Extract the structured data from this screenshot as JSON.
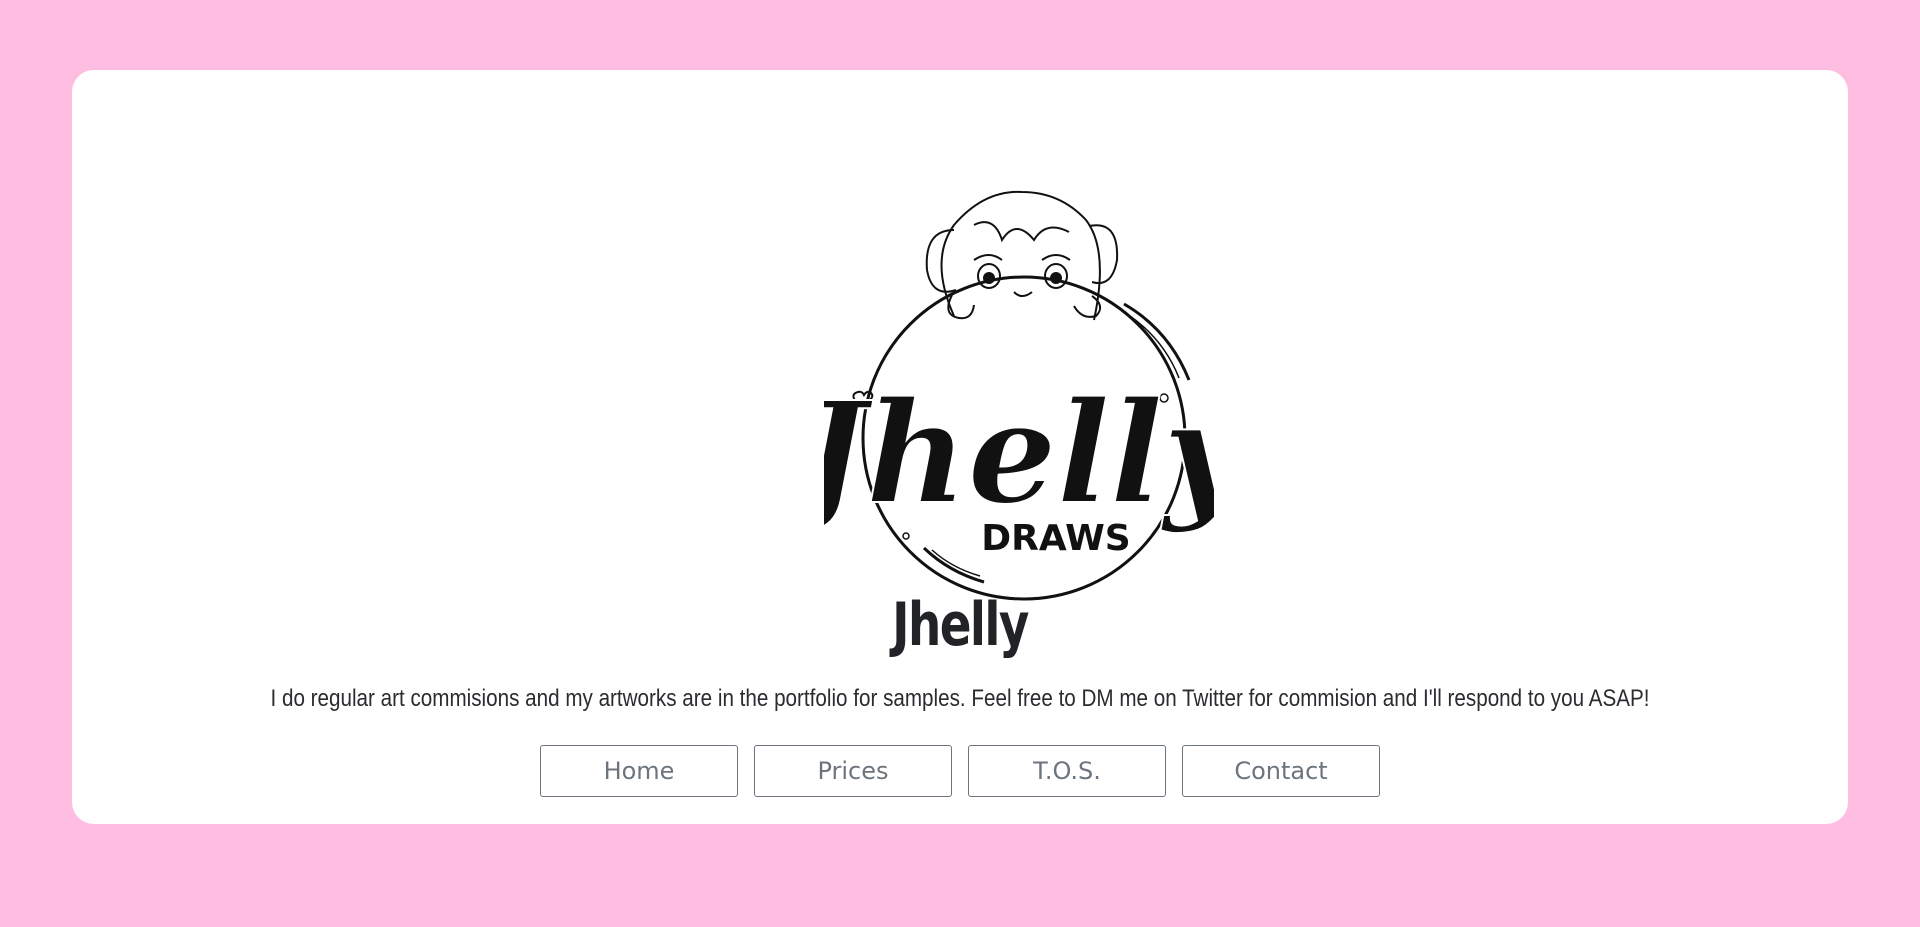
{
  "profile": {
    "name": "Jhelly",
    "description": "I do regular art commisions and my artworks are in the portfolio for samples. Feel free to DM me on Twitter for commision and I'll respond to you ASAP!"
  },
  "logo": {
    "script_text": "Jhelly",
    "sub_text": "DRAWS",
    "icon": "chibi-girl-peeking-over-bubble-logo"
  },
  "nav": {
    "home": "Home",
    "prices": "Prices",
    "tos": "T.O.S.",
    "contact": "Contact"
  },
  "colors": {
    "page_background": "#ffbde2",
    "card_background": "#ffffff",
    "button_border": "#6c757d",
    "title_text": "#222326"
  }
}
